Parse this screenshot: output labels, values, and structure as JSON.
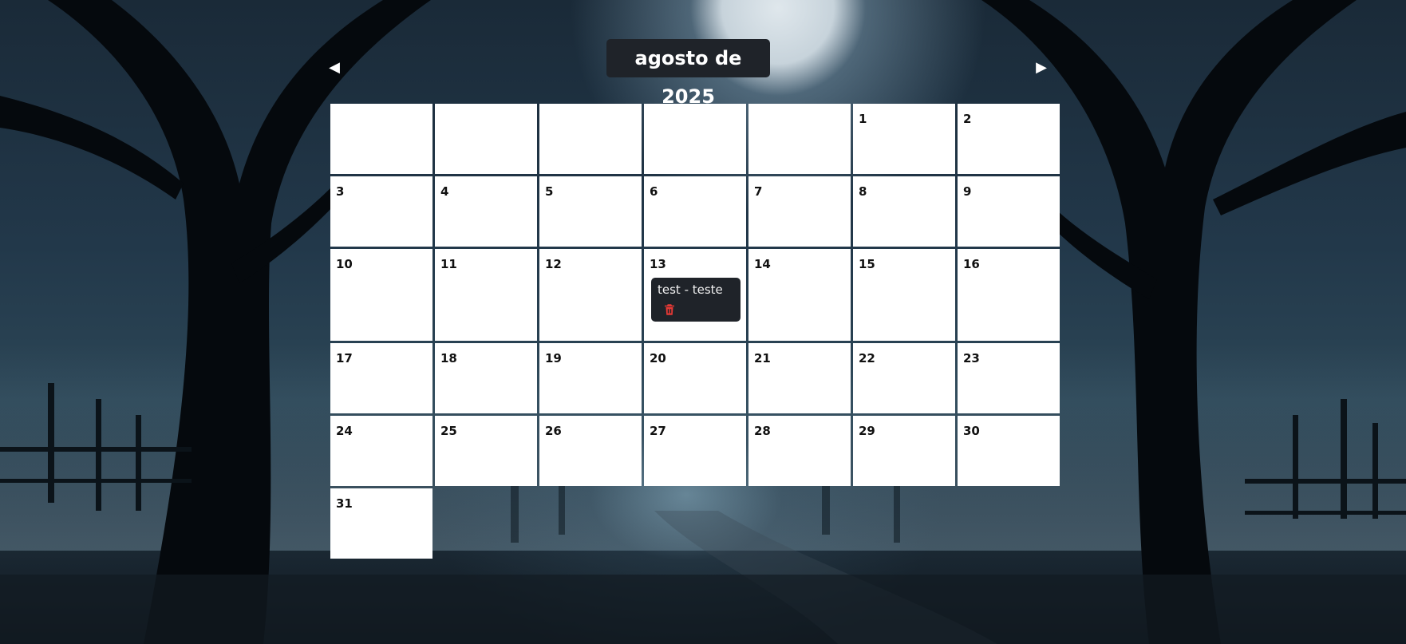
{
  "calendar": {
    "month_title": "agosto de 2025",
    "prev_icon": "◀",
    "next_icon": "▶",
    "days": [
      "1",
      "2",
      "3",
      "4",
      "5",
      "6",
      "7",
      "8",
      "9",
      "10",
      "11",
      "12",
      "13",
      "14",
      "15",
      "16",
      "17",
      "18",
      "19",
      "20",
      "21",
      "22",
      "23",
      "24",
      "25",
      "26",
      "27",
      "28",
      "29",
      "30",
      "31"
    ],
    "event": {
      "day": "13",
      "title": "test - teste",
      "delete_icon": "trash-icon"
    }
  },
  "colors": {
    "panel_dark": "#1f2329",
    "cell_bg": "#ffffff",
    "delete_red": "#e53935"
  }
}
